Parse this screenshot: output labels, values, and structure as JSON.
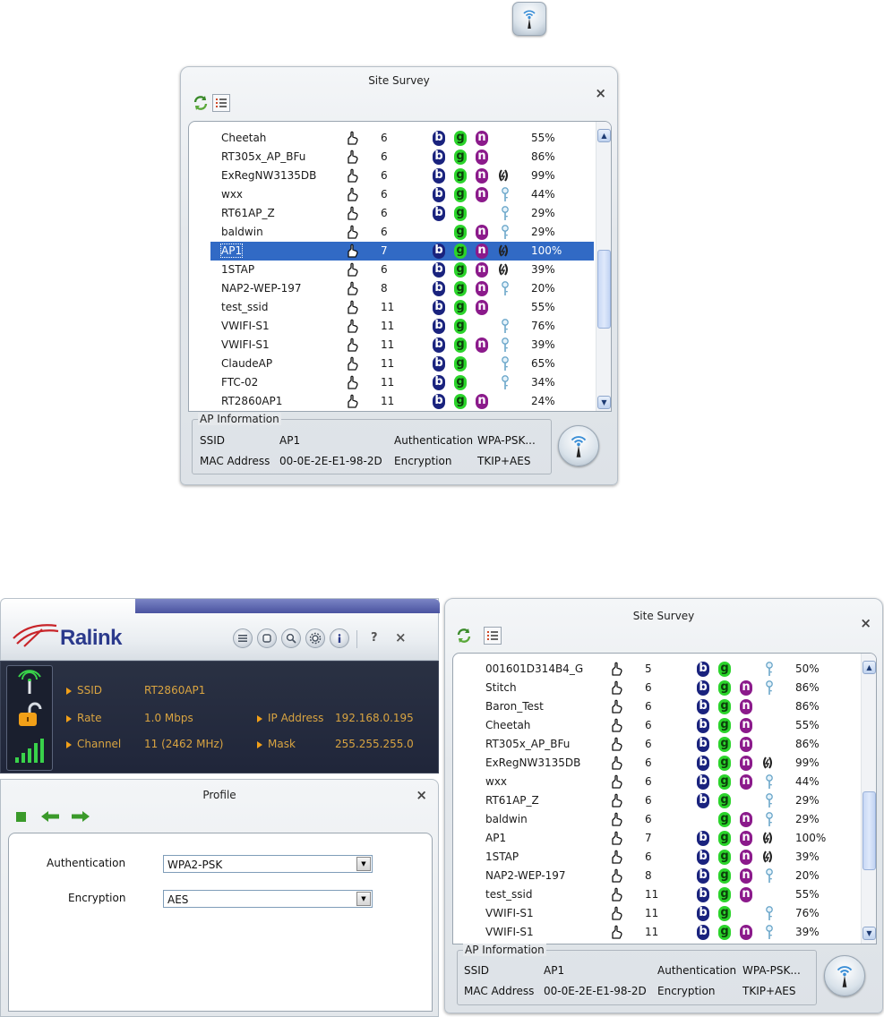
{
  "top_survey": {
    "title": "Site Survey",
    "close": "×",
    "rows": [
      {
        "ssid": "Cheetah",
        "channel": "6",
        "b": true,
        "g": true,
        "n": true,
        "wmm": false,
        "key": false,
        "signal": "55%"
      },
      {
        "ssid": "RT305x_AP_BFu",
        "channel": "6",
        "b": true,
        "g": true,
        "n": true,
        "wmm": false,
        "key": false,
        "signal": "86%"
      },
      {
        "ssid": "ExRegNW3135DB",
        "channel": "6",
        "b": true,
        "g": true,
        "n": true,
        "wmm": true,
        "key": false,
        "signal": "99%"
      },
      {
        "ssid": "wxx",
        "channel": "6",
        "b": true,
        "g": true,
        "n": true,
        "wmm": false,
        "key": true,
        "signal": "44%"
      },
      {
        "ssid": "RT61AP_Z",
        "channel": "6",
        "b": true,
        "g": true,
        "n": false,
        "wmm": false,
        "key": true,
        "signal": "29%"
      },
      {
        "ssid": "baldwin",
        "channel": "6",
        "b": false,
        "g": true,
        "n": true,
        "wmm": false,
        "key": true,
        "signal": "29%"
      },
      {
        "ssid": "AP1",
        "channel": "7",
        "b": true,
        "g": true,
        "n": true,
        "wmm": true,
        "key": false,
        "signal": "100%",
        "selected": true
      },
      {
        "ssid": "1STAP",
        "channel": "6",
        "b": true,
        "g": true,
        "n": true,
        "wmm": true,
        "key": false,
        "signal": "39%"
      },
      {
        "ssid": "NAP2-WEP-197",
        "channel": "8",
        "b": true,
        "g": true,
        "n": true,
        "wmm": false,
        "key": true,
        "signal": "20%"
      },
      {
        "ssid": "test_ssid",
        "channel": "11",
        "b": true,
        "g": true,
        "n": true,
        "wmm": false,
        "key": false,
        "signal": "55%"
      },
      {
        "ssid": "VWIFI-S1",
        "channel": "11",
        "b": true,
        "g": true,
        "n": false,
        "wmm": false,
        "key": true,
        "signal": "76%"
      },
      {
        "ssid": "VWIFI-S1",
        "channel": "11",
        "b": true,
        "g": true,
        "n": true,
        "wmm": false,
        "key": true,
        "signal": "39%"
      },
      {
        "ssid": "ClaudeAP",
        "channel": "11",
        "b": true,
        "g": true,
        "n": false,
        "wmm": false,
        "key": true,
        "signal": "65%"
      },
      {
        "ssid": "FTC-02",
        "channel": "11",
        "b": true,
        "g": true,
        "n": false,
        "wmm": false,
        "key": true,
        "signal": "34%"
      },
      {
        "ssid": "RT2860AP1",
        "channel": "11",
        "b": true,
        "g": true,
        "n": true,
        "wmm": false,
        "key": false,
        "signal": "24%"
      }
    ],
    "ap_info": {
      "legend": "AP Information",
      "ssid_label": "SSID",
      "ssid_value": "AP1",
      "auth_label": "Authentication",
      "auth_value": "WPA-PSK...",
      "mac_label": "MAC Address",
      "mac_value": "00-0E-2E-E1-98-2D",
      "enc_label": "Encryption",
      "enc_value": "TKIP+AES"
    }
  },
  "bottom_survey": {
    "title": "Site Survey",
    "close": "×",
    "rows": [
      {
        "ssid": "001601D314B4_G",
        "channel": "5",
        "b": true,
        "g": true,
        "n": false,
        "wmm": false,
        "key": true,
        "signal": "50%"
      },
      {
        "ssid": "Stitch",
        "channel": "6",
        "b": true,
        "g": true,
        "n": true,
        "wmm": false,
        "key": true,
        "signal": "86%"
      },
      {
        "ssid": "Baron_Test",
        "channel": "6",
        "b": true,
        "g": true,
        "n": true,
        "wmm": false,
        "key": false,
        "signal": "86%"
      },
      {
        "ssid": "Cheetah",
        "channel": "6",
        "b": true,
        "g": true,
        "n": true,
        "wmm": false,
        "key": false,
        "signal": "55%"
      },
      {
        "ssid": "RT305x_AP_BFu",
        "channel": "6",
        "b": true,
        "g": true,
        "n": true,
        "wmm": false,
        "key": false,
        "signal": "86%"
      },
      {
        "ssid": "ExRegNW3135DB",
        "channel": "6",
        "b": true,
        "g": true,
        "n": true,
        "wmm": true,
        "key": false,
        "signal": "99%"
      },
      {
        "ssid": "wxx",
        "channel": "6",
        "b": true,
        "g": true,
        "n": true,
        "wmm": false,
        "key": true,
        "signal": "44%"
      },
      {
        "ssid": "RT61AP_Z",
        "channel": "6",
        "b": true,
        "g": true,
        "n": false,
        "wmm": false,
        "key": true,
        "signal": "29%"
      },
      {
        "ssid": "baldwin",
        "channel": "6",
        "b": false,
        "g": true,
        "n": true,
        "wmm": false,
        "key": true,
        "signal": "29%"
      },
      {
        "ssid": "AP1",
        "channel": "7",
        "b": true,
        "g": true,
        "n": true,
        "wmm": true,
        "key": false,
        "signal": "100%"
      },
      {
        "ssid": "1STAP",
        "channel": "6",
        "b": true,
        "g": true,
        "n": true,
        "wmm": true,
        "key": false,
        "signal": "39%"
      },
      {
        "ssid": "NAP2-WEP-197",
        "channel": "8",
        "b": true,
        "g": true,
        "n": true,
        "wmm": false,
        "key": true,
        "signal": "20%"
      },
      {
        "ssid": "test_ssid",
        "channel": "11",
        "b": true,
        "g": true,
        "n": true,
        "wmm": false,
        "key": false,
        "signal": "55%"
      },
      {
        "ssid": "VWIFI-S1",
        "channel": "11",
        "b": true,
        "g": true,
        "n": false,
        "wmm": false,
        "key": true,
        "signal": "76%"
      },
      {
        "ssid": "VWIFI-S1",
        "channel": "11",
        "b": true,
        "g": true,
        "n": true,
        "wmm": false,
        "key": true,
        "signal": "39%"
      }
    ],
    "ap_info": {
      "legend": "AP Information",
      "ssid_label": "SSID",
      "ssid_value": "AP1",
      "auth_label": "Authentication",
      "auth_value": "WPA-PSK...",
      "mac_label": "MAC Address",
      "mac_value": "00-0E-2E-E1-98-2D",
      "enc_label": "Encryption",
      "enc_value": "TKIP+AES"
    }
  },
  "ralink": {
    "logo_text": "Ralink",
    "help": "?",
    "close": "×",
    "ssid_label": "SSID",
    "ssid_value": "RT2860AP1",
    "rate_label": "Rate",
    "rate_value": "1.0 Mbps",
    "channel_label": "Channel",
    "channel_value": "11 (2462 MHz)",
    "ip_label": "IP Address",
    "ip_value": "192.168.0.195",
    "mask_label": "Mask",
    "mask_value": "255.255.255.0"
  },
  "profile": {
    "title": "Profile",
    "close": "×",
    "auth_label": "Authentication",
    "auth_value": "WPA2-PSK",
    "enc_label": "Encryption",
    "enc_value": "AES"
  },
  "icons": [
    "wireless-antenna-icon",
    "refresh-icon",
    "list-view-icon",
    "hand-connect-icon",
    "wmm-arrows-icon",
    "key-icon",
    "scroll-up-icon",
    "scroll-down-icon",
    "profile-icon",
    "search-icon",
    "settings-icon",
    "info-icon",
    "lock-icon",
    "signal-bars-icon",
    "stop-icon",
    "back-arrow-icon",
    "forward-arrow-icon"
  ],
  "colors": {
    "selection": "#316ac5",
    "badge_b": "#1a237e",
    "badge_g": "#2bd42b",
    "badge_n": "#8b1a8b",
    "status_text": "#d9a441",
    "status_bg": "#232a3d"
  }
}
